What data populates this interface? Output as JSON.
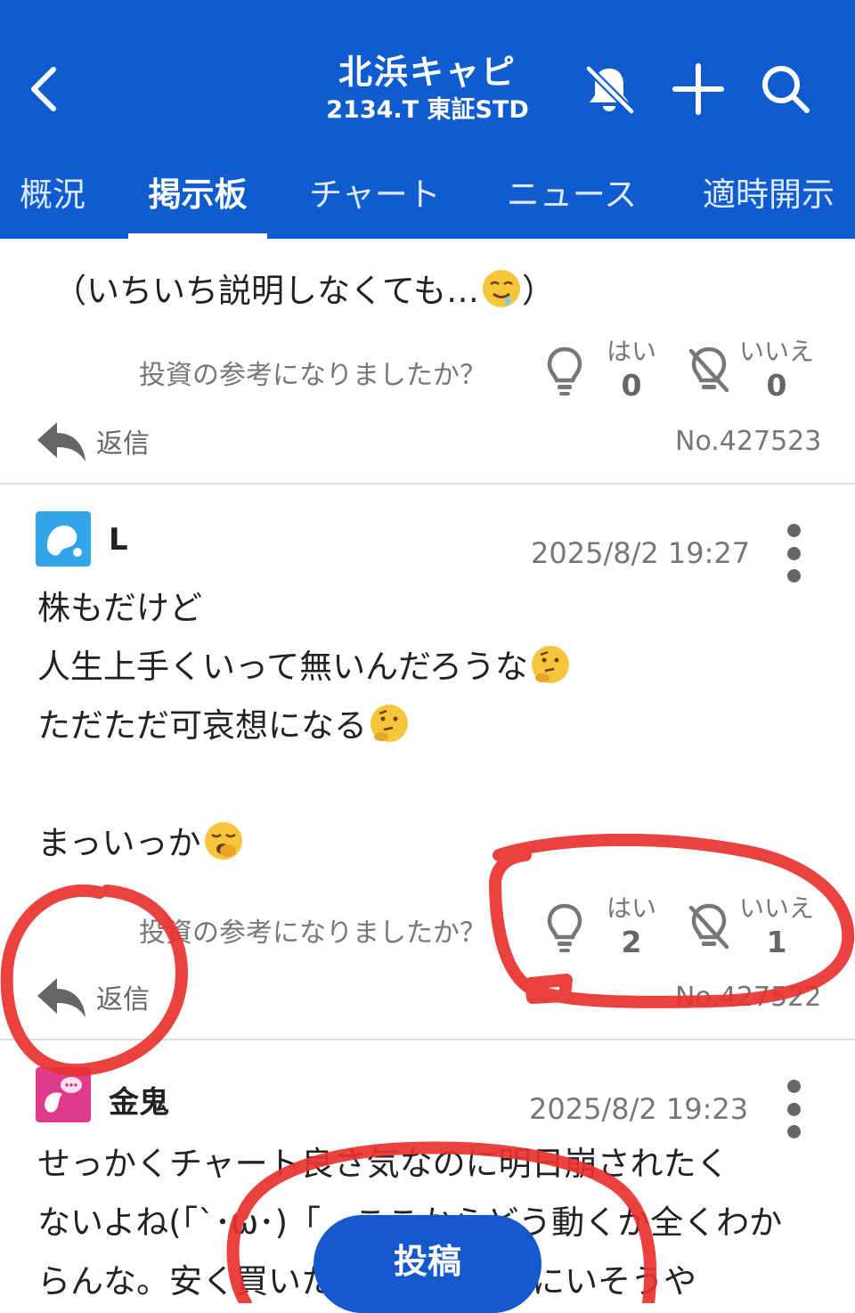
{
  "header": {
    "title": "北浜キャピ",
    "subtitle": "2134.T 東証STD",
    "background": "#0f5bd0",
    "icons": [
      "back-chevron-icon",
      "bell-off-icon",
      "plus-icon",
      "search-icon"
    ]
  },
  "tabs": [
    {
      "label": "概況"
    },
    {
      "label": "掲示板"
    },
    {
      "label": "チャート"
    },
    {
      "label": "ニュース"
    },
    {
      "label": "適時開示"
    }
  ],
  "active_tab": "掲示板",
  "posts": [
    {
      "text": "（いちいち説明しなくても…",
      "text_end": "）",
      "useful_question": "投資の参考になりましたか？",
      "yes_label": "はい",
      "yes_count": "0",
      "no_label": "いいえ",
      "no_count": "0",
      "reply_label": "返信",
      "number": "No.427523"
    },
    {
      "username": "L",
      "timestamp": "2025/8/2 19:27",
      "line1": "株もだけど",
      "line2": "人生上手くいって無いんだろうな",
      "line3": "ただただ可哀想になる",
      "line4": "まっいっか",
      "useful_question": "投資の参考になりましたか？",
      "yes_label": "はい",
      "yes_count": "2",
      "no_label": "いいえ",
      "no_count": "1",
      "reply_label": "返信",
      "number": "No.427522"
    },
    {
      "username": "金鬼",
      "timestamp": "2025/8/2 19:23",
      "line1": "せっかくチャート良さ気なのに明日崩されたく",
      "line2": "ないよね(「`･ω･)「　ここからどう動くか全くわか",
      "line3": "らんな。安く買いたいなら、なりにいそうや"
    }
  ],
  "post_button": {
    "label": "投稿"
  },
  "colors": {
    "accent": "#0f5bd0",
    "annotation": "#e8322e"
  }
}
